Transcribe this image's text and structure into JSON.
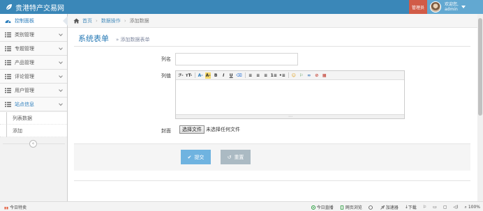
{
  "navbar": {
    "brand": "贵港特产交易网",
    "role_badge": "管理员",
    "welcome": "欢迎您,",
    "username": "admin"
  },
  "sidebar": {
    "items": [
      {
        "label": "控制面板",
        "icon": "dashboard-icon"
      },
      {
        "label": "类别管理",
        "icon": "list-icon"
      },
      {
        "label": "专题管理",
        "icon": "list-icon"
      },
      {
        "label": "产品管理",
        "icon": "list-icon"
      },
      {
        "label": "评论管理",
        "icon": "list-icon"
      },
      {
        "label": "用户管理",
        "icon": "list-icon"
      },
      {
        "label": "站点信息",
        "icon": "list-icon"
      }
    ],
    "subitems": [
      {
        "label": "列表数据"
      },
      {
        "label": "添加"
      }
    ],
    "collapse_glyph": "«"
  },
  "breadcrumb": {
    "home": "首页",
    "section": "数据操作",
    "current": "添加数据"
  },
  "page": {
    "title": "系统表单",
    "subtitle": "» 添加数据表单"
  },
  "form": {
    "name_label": "列名",
    "name_value": "",
    "value_label": "列值",
    "cover_label": "封面",
    "file_button": "选择文件",
    "file_status": "未选择任何文件",
    "submit_label": "提交",
    "reset_label": "重置"
  },
  "editor": {
    "toolbar": [
      "ℱ-",
      "тT-",
      "A-",
      "A-",
      "B",
      "I",
      "U",
      "⌫",
      "≡",
      "≡",
      "≡",
      "1≡",
      "•≡",
      "☺",
      "⚐",
      "∞",
      "⊘",
      "▦"
    ]
  },
  "statusbar": {
    "left": "今日特卖",
    "items": [
      "今日直播",
      "网页浏览",
      "加速器",
      "下载"
    ],
    "zoom": "100%"
  },
  "colors": {
    "navbar": "#3a87b8",
    "accent": "#2679b5",
    "badge": "#d15b47",
    "submit": "#6fb3e0",
    "reset": "#abbac3"
  }
}
